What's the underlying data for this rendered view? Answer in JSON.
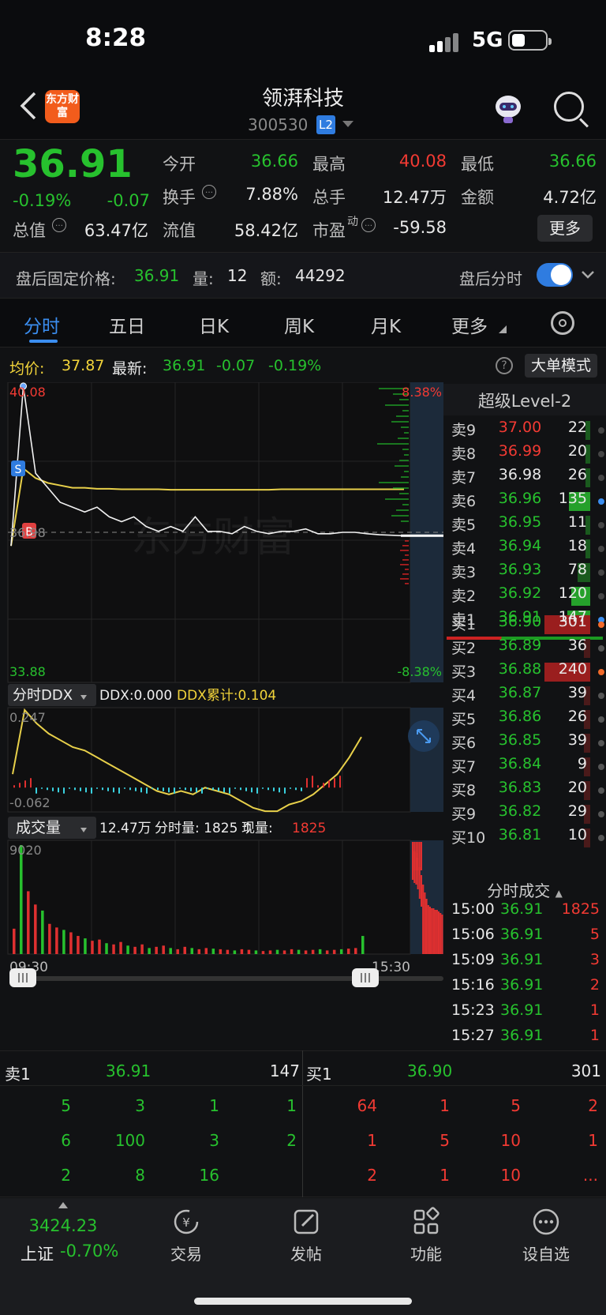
{
  "status": {
    "time": "8:28",
    "network": "5G"
  },
  "header": {
    "logo": "东方财富",
    "stock_name": "领湃科技",
    "code": "300530",
    "level_badge": "L2",
    "search_icon": "search-icon"
  },
  "quote": {
    "price": "36.91",
    "change_pct": "-0.19%",
    "change": "-0.07",
    "open_label": "今开",
    "open": "36.66",
    "high_label": "最高",
    "high": "40.08",
    "low_label": "最低",
    "low": "36.66",
    "turnover_label": "换手",
    "turnover": "7.88%",
    "volume_label": "总手",
    "volume": "12.47万",
    "amount_label": "金额",
    "amount": "4.72亿",
    "mktcap_label": "总值",
    "mktcap": "63.47亿",
    "float_label": "流值",
    "float": "58.42亿",
    "pe_label": "市盈",
    "pe_sup": "动",
    "pe": "-59.58",
    "more_button": "更多"
  },
  "after_hours": {
    "price_label": "盘后固定价格:",
    "price": "36.91",
    "vol_label": "量:",
    "vol": "12",
    "amt_label": "额:",
    "amt": "44292",
    "toggle_label": "盘后分时",
    "toggle_on": true
  },
  "tabs": [
    {
      "label": "分时",
      "active": true
    },
    {
      "label": "五日"
    },
    {
      "label": "日K"
    },
    {
      "label": "周K"
    },
    {
      "label": "月K"
    },
    {
      "label": "更多"
    }
  ],
  "avg_line": {
    "avg_label": "均价:",
    "avg": "37.87",
    "latest_label": "最新:",
    "latest": "36.91",
    "chg": "-0.07",
    "pct": "-0.19%",
    "big_mode": "大单模式"
  },
  "chart_data": [
    {
      "type": "line",
      "title": "分时",
      "ylim": [
        33.88,
        40.08
      ],
      "y_tick_labels": [
        "40.08",
        "36.98",
        "33.88"
      ],
      "right_tick_labels": [
        "8.38%",
        "-8.38%"
      ],
      "x": [
        "09:30",
        "15:30"
      ],
      "series": [
        {
          "values": [
            36.7,
            40.0,
            38.2,
            37.9,
            37.6,
            37.5,
            37.4,
            37.5,
            37.3,
            37.2,
            37.3,
            37.1,
            37.0,
            37.1,
            37.0,
            37.3,
            37.0,
            37.0,
            36.95,
            37.1,
            37.0,
            36.95,
            37.0,
            37.0,
            37.05,
            36.95,
            36.95,
            36.98,
            36.98,
            36.95,
            36.93,
            36.92,
            36.91
          ]
        },
        {
          "values": [
            36.7,
            38.3,
            38.1,
            38.0,
            37.95,
            37.9,
            37.9,
            37.88,
            37.88,
            37.87,
            37.87,
            37.87,
            37.87,
            37.86,
            37.86,
            37.86,
            37.86,
            37.86,
            37.86,
            37.86,
            37.86,
            37.86,
            37.87,
            37.87,
            37.87,
            37.87,
            37.87,
            37.87,
            37.87,
            37.87,
            37.87,
            37.87,
            37.87
          ]
        }
      ],
      "markers": [
        "S",
        "B"
      ]
    },
    {
      "type": "line",
      "title": "分时DDX",
      "label_ddx": "DDX:0.000",
      "label_cum": "DDX累计:0.104",
      "ylim": [
        -0.062,
        0.247
      ],
      "y_tick_labels": [
        "0.247",
        "-0.062"
      ],
      "series": [
        {
          "values": [
            0.05,
            0.24,
            0.2,
            0.17,
            0.15,
            0.13,
            0.12,
            0.1,
            0.08,
            0.06,
            0.04,
            0.02,
            0.0,
            -0.01,
            0.0,
            -0.01,
            0.01,
            0.0,
            -0.01,
            -0.03,
            -0.05,
            -0.06,
            -0.06,
            -0.04,
            -0.03,
            -0.01,
            0.02,
            0.05,
            0.1,
            0.16
          ]
        }
      ]
    },
    {
      "type": "bar",
      "title": "成交量",
      "summary": "12.47万",
      "label_minute": "分时量: 1825",
      "label_current": "现量:",
      "current": "1825",
      "ylim": [
        0,
        9020
      ],
      "y_tick_labels": [
        "9020"
      ],
      "x": [
        "09:30",
        "15:30"
      ],
      "values": [
        2100,
        9020,
        5200,
        4100,
        3600,
        2500,
        2200,
        2000,
        1800,
        1500,
        1300,
        1100,
        1200,
        900,
        800,
        1000,
        700,
        600,
        800,
        500,
        600,
        700,
        500,
        400,
        600,
        500,
        400,
        500,
        450,
        400,
        350,
        300,
        400,
        350,
        300,
        250,
        300,
        350,
        300,
        400,
        350,
        300,
        350,
        400,
        300,
        350,
        400,
        450,
        500,
        1500
      ]
    }
  ],
  "level2": {
    "title": "超级Level-2",
    "asks": [
      {
        "label": "卖9",
        "price": "37.00",
        "vol": "22"
      },
      {
        "label": "卖8",
        "price": "36.99",
        "vol": "20"
      },
      {
        "label": "卖7",
        "price": "36.98",
        "vol": "26"
      },
      {
        "label": "卖6",
        "price": "36.96",
        "vol": "135"
      },
      {
        "label": "卖5",
        "price": "36.95",
        "vol": "11"
      },
      {
        "label": "卖4",
        "price": "36.94",
        "vol": "18"
      },
      {
        "label": "卖3",
        "price": "36.93",
        "vol": "78"
      },
      {
        "label": "卖2",
        "price": "36.92",
        "vol": "120"
      },
      {
        "label": "卖1",
        "price": "36.91",
        "vol": "147"
      }
    ],
    "bids": [
      {
        "label": "买1",
        "price": "36.90",
        "vol": "301"
      },
      {
        "label": "买2",
        "price": "36.89",
        "vol": "36"
      },
      {
        "label": "买3",
        "price": "36.88",
        "vol": "240"
      },
      {
        "label": "买4",
        "price": "36.87",
        "vol": "39"
      },
      {
        "label": "买5",
        "price": "36.86",
        "vol": "26"
      },
      {
        "label": "买6",
        "price": "36.85",
        "vol": "39"
      },
      {
        "label": "买7",
        "price": "36.84",
        "vol": "9"
      },
      {
        "label": "买8",
        "price": "36.83",
        "vol": "20"
      },
      {
        "label": "买9",
        "price": "36.82",
        "vol": "29"
      },
      {
        "label": "买10",
        "price": "36.81",
        "vol": "10"
      }
    ]
  },
  "ticks": {
    "title": "分时成交",
    "rows": [
      {
        "t": "15:00",
        "p": "36.91",
        "v": "1825"
      },
      {
        "t": "15:06",
        "p": "36.91",
        "v": "5"
      },
      {
        "t": "15:09",
        "p": "36.91",
        "v": "3"
      },
      {
        "t": "15:16",
        "p": "36.91",
        "v": "2"
      },
      {
        "t": "15:23",
        "p": "36.91",
        "v": "1"
      },
      {
        "t": "15:27",
        "p": "36.91",
        "v": "1"
      }
    ]
  },
  "queue": {
    "sell_label": "卖1",
    "sell_price": "36.91",
    "sell_total": "147",
    "buy_label": "买1",
    "buy_price": "36.90",
    "buy_total": "301",
    "sell_orders": [
      "5",
      "3",
      "1",
      "1",
      "6",
      "100",
      "3",
      "2",
      "2",
      "8",
      "16"
    ],
    "buy_orders": [
      "64",
      "1",
      "5",
      "2",
      "1",
      "5",
      "10",
      "1",
      "2",
      "1",
      "10",
      "..."
    ]
  },
  "nav": {
    "index_value": "3424.23",
    "index_name": "上证",
    "index_pct": "-0.70%",
    "items": [
      "交易",
      "发帖",
      "功能",
      "设自选"
    ]
  }
}
